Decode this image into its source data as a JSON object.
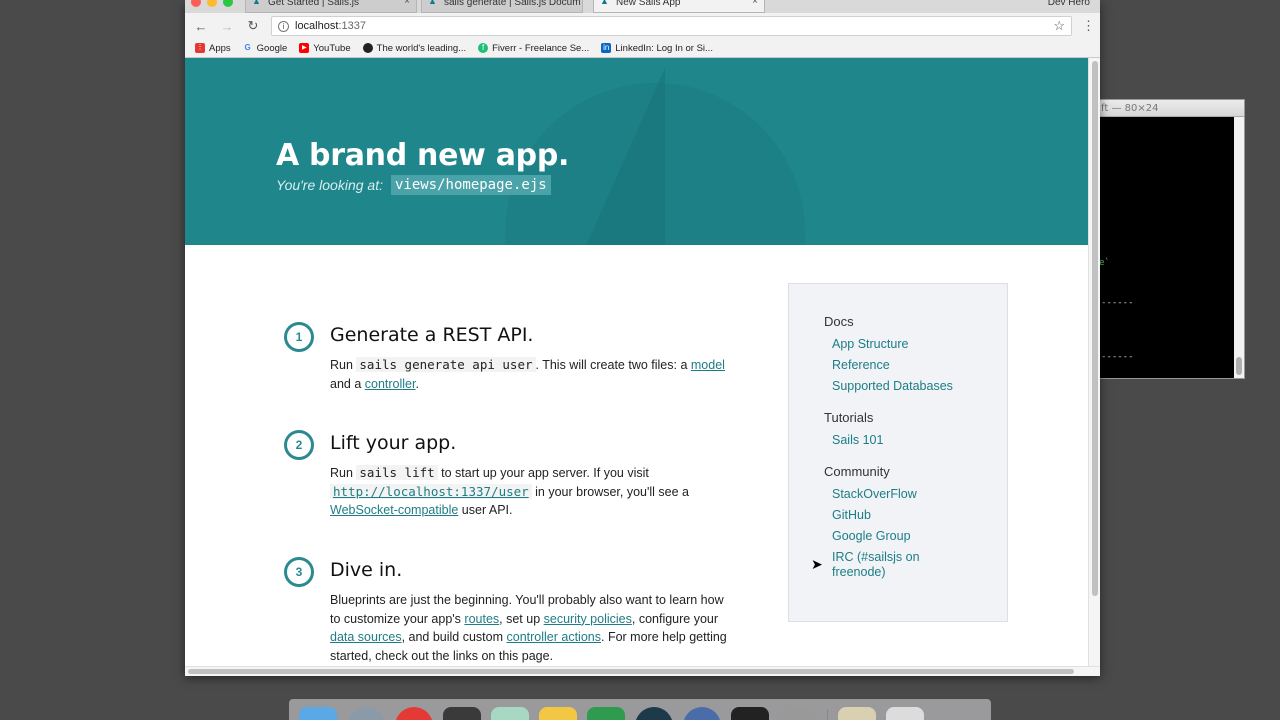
{
  "terminal": {
    "title": "ft — 80×24",
    "lines": [
      "e`",
      "------",
      "------"
    ]
  },
  "browser": {
    "tabs": [
      {
        "label": "Get Started | Sails.js",
        "close": "×"
      },
      {
        "label": "sails generate | Sails.js Docum",
        "close": "×"
      },
      {
        "label": "New Sails App",
        "close": "×"
      }
    ],
    "profile": "Dev Hero",
    "url_host": "localhost",
    "url_port": ":1337",
    "bookmarks": [
      {
        "label": "Apps",
        "icon": "apps-grid-icon",
        "color": "#e53935"
      },
      {
        "label": "Google",
        "icon": "google-icon",
        "color": "#4285f4"
      },
      {
        "label": "YouTube",
        "icon": "youtube-icon",
        "color": "#ff0000"
      },
      {
        "label": "The world's leading...",
        "icon": "github-icon",
        "color": "#222222"
      },
      {
        "label": "Fiverr - Freelance Se...",
        "icon": "fiverr-icon",
        "color": "#1dbf73"
      },
      {
        "label": "LinkedIn: Log In or Si...",
        "icon": "linkedin-icon",
        "color": "#0a66c2"
      }
    ]
  },
  "hero": {
    "title": "A brand new app.",
    "sub_label": "You're looking at:",
    "sub_code": "views/homepage.ejs"
  },
  "steps": [
    {
      "num": "1",
      "title": "Generate a REST API.",
      "p1": "Run ",
      "code": "sails generate api user",
      "p2": ". This will create two files: a ",
      "link1": "model",
      "p3": " and a ",
      "link2": "controller",
      "p4": "."
    },
    {
      "num": "2",
      "title": "Lift your app.",
      "p1": "Run ",
      "code": "sails lift",
      "p2": " to start up your app server. If you visit ",
      "link1": "http://localhost:1337/user",
      "p3": " in your browser, you'll see a ",
      "link2": "WebSocket-compatible",
      "p4": " user API."
    },
    {
      "num": "3",
      "title": "Dive in.",
      "p1": "Blueprints are just the beginning. You'll probably also want to learn how to customize your app's ",
      "link1": "routes",
      "p2": ", set up ",
      "link2": "security policies",
      "p3": ", configure your ",
      "link3": "data sources",
      "p4": ", and build custom ",
      "link4": "controller actions",
      "p5": ". For more help getting started, check out the links on this page."
    }
  ],
  "sidebar": {
    "docs_heading": "Docs",
    "docs": [
      "App Structure",
      "Reference",
      "Supported Databases"
    ],
    "tutorials_heading": "Tutorials",
    "tutorials": [
      "Sails 101"
    ],
    "community_heading": "Community",
    "community": [
      "StackOverFlow",
      "GitHub",
      "Google Group",
      "IRC (#sailsjs on freenode)"
    ]
  },
  "colors": {
    "accent": "#1f868c",
    "link": "#1d7d86"
  }
}
